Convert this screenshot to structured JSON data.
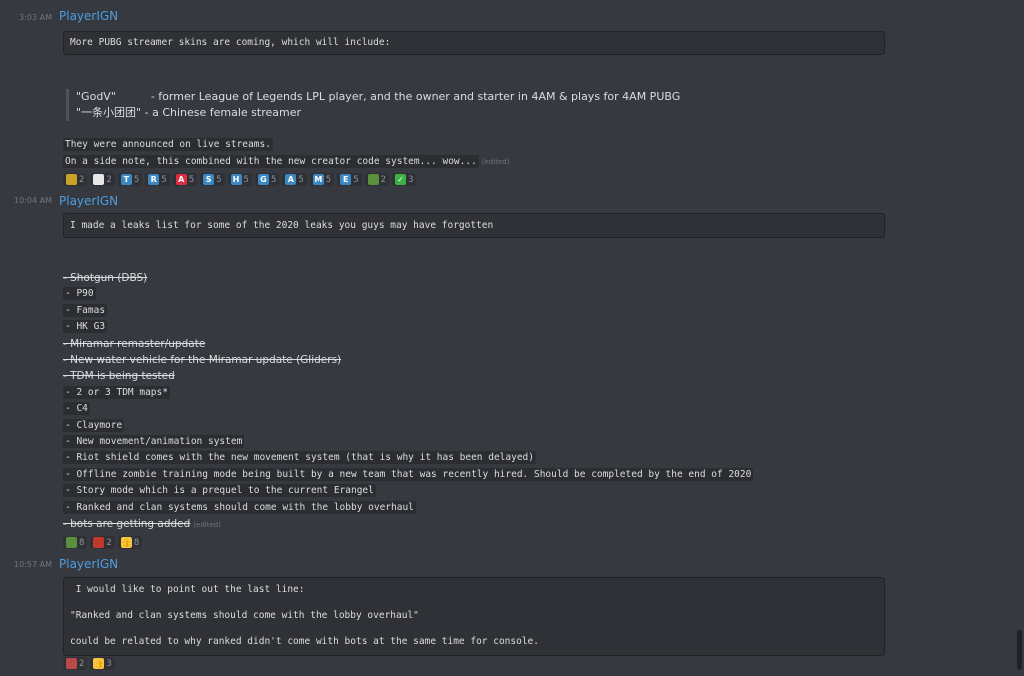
{
  "messages": [
    {
      "timestamp": "3:03 AM",
      "username": "PlayerIGN",
      "code": "More PUBG streamer skins are coming, which will include:",
      "quote": [
        "\"GodV\"          - former League of Legends LPL player, and the owner and starter in 4AM & plays for 4AM PUBG",
        "\"一条小团团\" - a Chinese female streamer"
      ],
      "lines": [
        "They were announced on live streams.",
        "On a side note, this combined with the new creator code system... wow..."
      ],
      "edited": "(edited)",
      "reactions": [
        {
          "icon": "pepe-icon",
          "label": "",
          "count": "2",
          "color": "#c9a227"
        },
        {
          "icon": "flag-korea-icon",
          "label": "",
          "count": "2",
          "color": "#e8e8e8"
        },
        {
          "icon": "letter-t-icon",
          "label": "T",
          "count": "5",
          "color": "#3b88c3"
        },
        {
          "icon": "letter-r-icon",
          "label": "R",
          "count": "5",
          "color": "#3b88c3"
        },
        {
          "icon": "letter-a-red-icon",
          "label": "A",
          "count": "5",
          "color": "#dd2e44"
        },
        {
          "icon": "letter-s-icon",
          "label": "S",
          "count": "5",
          "color": "#3b88c3"
        },
        {
          "icon": "letter-h-icon",
          "label": "H",
          "count": "5",
          "color": "#3b88c3"
        },
        {
          "icon": "letter-g-icon",
          "label": "G",
          "count": "5",
          "color": "#3b88c3"
        },
        {
          "icon": "letter-a-icon",
          "label": "A",
          "count": "5",
          "color": "#3b88c3"
        },
        {
          "icon": "letter-m-icon",
          "label": "M",
          "count": "5",
          "color": "#3b88c3"
        },
        {
          "icon": "letter-e-icon",
          "label": "E",
          "count": "5",
          "color": "#3b88c3"
        },
        {
          "icon": "pepe-green-icon",
          "label": "",
          "count": "2",
          "color": "#5a8f3c"
        },
        {
          "icon": "check-mark-icon",
          "label": "✓",
          "count": "3",
          "color": "#3cb043"
        }
      ]
    },
    {
      "timestamp": "10:04 AM",
      "username": "PlayerIGN",
      "code": "I made a leaks list for some of the 2020 leaks you guys may have forgotten",
      "list": [
        {
          "text": "- Shotgun (DBS)",
          "strike": true
        },
        {
          "text": "- P90",
          "strike": false
        },
        {
          "text": "- Famas",
          "strike": false
        },
        {
          "text": "- HK G3",
          "strike": false
        },
        {
          "text": "- Miramar remaster/update",
          "strike": true
        },
        {
          "text": "- New water vehicle for the Miramar update (Gliders)",
          "strike": true
        },
        {
          "text": "- TDM is being tested",
          "strike": true
        },
        {
          "text": "- 2 or 3 TDM maps*",
          "strike": false
        },
        {
          "text": "- C4",
          "strike": false
        },
        {
          "text": "- Claymore",
          "strike": false
        },
        {
          "text": "- New movement/animation system",
          "strike": false
        },
        {
          "text": "- Riot shield comes with the new movement system (that is why it has been delayed)",
          "strike": false
        },
        {
          "text": "- Offline zombie training mode being built by a new team that was recently hired. Should be completed by the end of 2020",
          "strike": false
        },
        {
          "text": "- Story mode which is a prequel to the current Erangel",
          "strike": false
        },
        {
          "text": "- Ranked and clan systems should come with the lobby overhaul",
          "strike": false
        },
        {
          "text": "- bots are getting added",
          "strike": true
        }
      ],
      "edited": "(edited)",
      "reactions": [
        {
          "icon": "pepe-green-icon",
          "label": "",
          "count": "8",
          "color": "#5a8f3c"
        },
        {
          "icon": "laughing-icon",
          "label": "",
          "count": "2",
          "color": "#c0392b"
        },
        {
          "icon": "thumbs-up-icon",
          "label": "👍",
          "count": "8",
          "color": "#f5c542"
        }
      ]
    },
    {
      "timestamp": "10:57 AM",
      "username": "PlayerIGN",
      "code_lines": [
        " I would like to point out the last line:",
        "\"Ranked and clan systems should come with the lobby overhaul\"",
        "could be related to why ranked didn't come with bots at the same time for console."
      ],
      "reactions": [
        {
          "icon": "pepe-red-icon",
          "label": "",
          "count": "2",
          "color": "#b94a48"
        },
        {
          "icon": "thumbs-up-icon",
          "label": "👍",
          "count": "3",
          "color": "#f5c542"
        }
      ]
    }
  ],
  "colors": {
    "background": "#36393f",
    "username": "#4f9de0",
    "codeblock": "#2f3136"
  }
}
